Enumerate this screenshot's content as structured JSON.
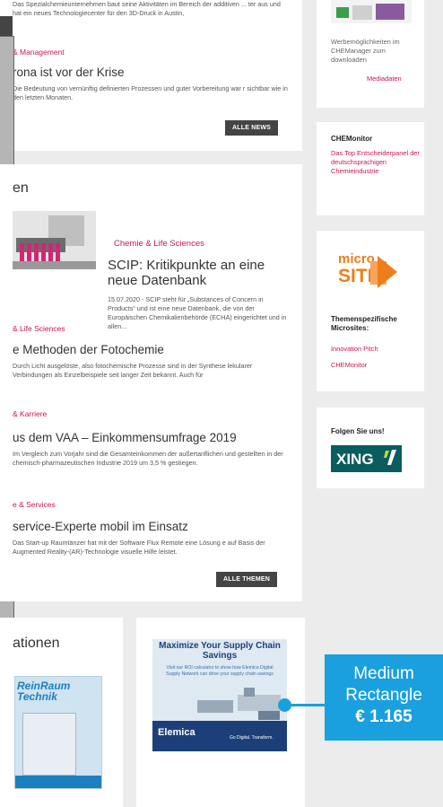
{
  "news": {
    "intro_text": "Das Spezialchemieunternehmen baut seine Aktivitäten im Bereich der additiven ... ter aus und hat ein neues Technologiecenter für den 3D-Druck in Austin,",
    "item": {
      "category": "& Management",
      "title": "rona ist vor der Krise",
      "text": "Die Bedeutung von vernünftig definierten Prozessen und guter Vorbereitung war r sichtbar wie in den letzten Monaten."
    },
    "button_label": "ALLE NEWS"
  },
  "themen": {
    "heading": "en",
    "featured": {
      "category": "Chemie & Life Sciences",
      "title": "SCIP: Kritikpunkte an eine neue Datenbank",
      "text": "15.07.2020 - SCIP steht für „Substances of Concern in Products“ und ist eine neue Datenbank, die von der Europäischen Chemikalienbehörde (ECHA) eingerichtet und in allen..."
    },
    "items": [
      {
        "category": "& Life Sciences",
        "title": "e Methoden der Fotochemie",
        "text": "Durch Licht ausgelöste, also fotochemische Prozesse sind in der Synthese lekularer Verbindungen als Einzelbeispiele seit langer Zeit bekannt. Auch für"
      },
      {
        "category": "& Karriere",
        "title": "us dem VAA – Einkommensumfrage 2019",
        "text": "Im Vergleich zum Vorjahr sind die Gesamteinkommen der außertariflichen und gestellten in der chemisch-pharmazeutischen Industrie 2019 um 3,5 % gestiegen."
      },
      {
        "category": "e & Services",
        "title": "service-Experte mobil im Einsatz",
        "text": "Das Start-up Raumtänzer hat mit der Software Flux Remote eine Lösung e auf Basis der Augmented Reality-(AR)-Technologie visuelle Hilfe leistet."
      }
    ],
    "button_label": "ALLE THEMEN"
  },
  "pubs": {
    "heading": "ationen",
    "magazine_title": "ReinRaum Technik"
  },
  "ad": {
    "headline": "Maximize Your Supply Chain Savings",
    "subtext": "Visit our ROI calculator to show how Elemica Digital Supply Network can drive your supply chain savings",
    "brand": "Elemica",
    "tagline": "Go Digital. Transform."
  },
  "sidebar": {
    "media": {
      "text": "Werbemöglichkeiten im CHEManager zum downloaden",
      "link": "Mediadaten"
    },
    "chemonitor": {
      "title": "CHEMonitor",
      "link": "Das Top Entscheiderpanel der deutschsprachigen Chemieindustrie"
    },
    "microsite": {
      "logo_text_top": "micro",
      "logo_text_bottom": "SITE",
      "title": "Themenspezifische Microsites:",
      "links": [
        "Innovation Pitch",
        "CHEMonitor"
      ]
    },
    "follow": {
      "title": "Folgen Sie uns!",
      "xing": "XING"
    }
  },
  "callout": {
    "line1": "Medium",
    "line2": "Rectangle",
    "price": "€ 1.165"
  },
  "colors": {
    "accent": "#c8174d",
    "callout": "#1aa0de",
    "xing": "#0a5d5e"
  }
}
